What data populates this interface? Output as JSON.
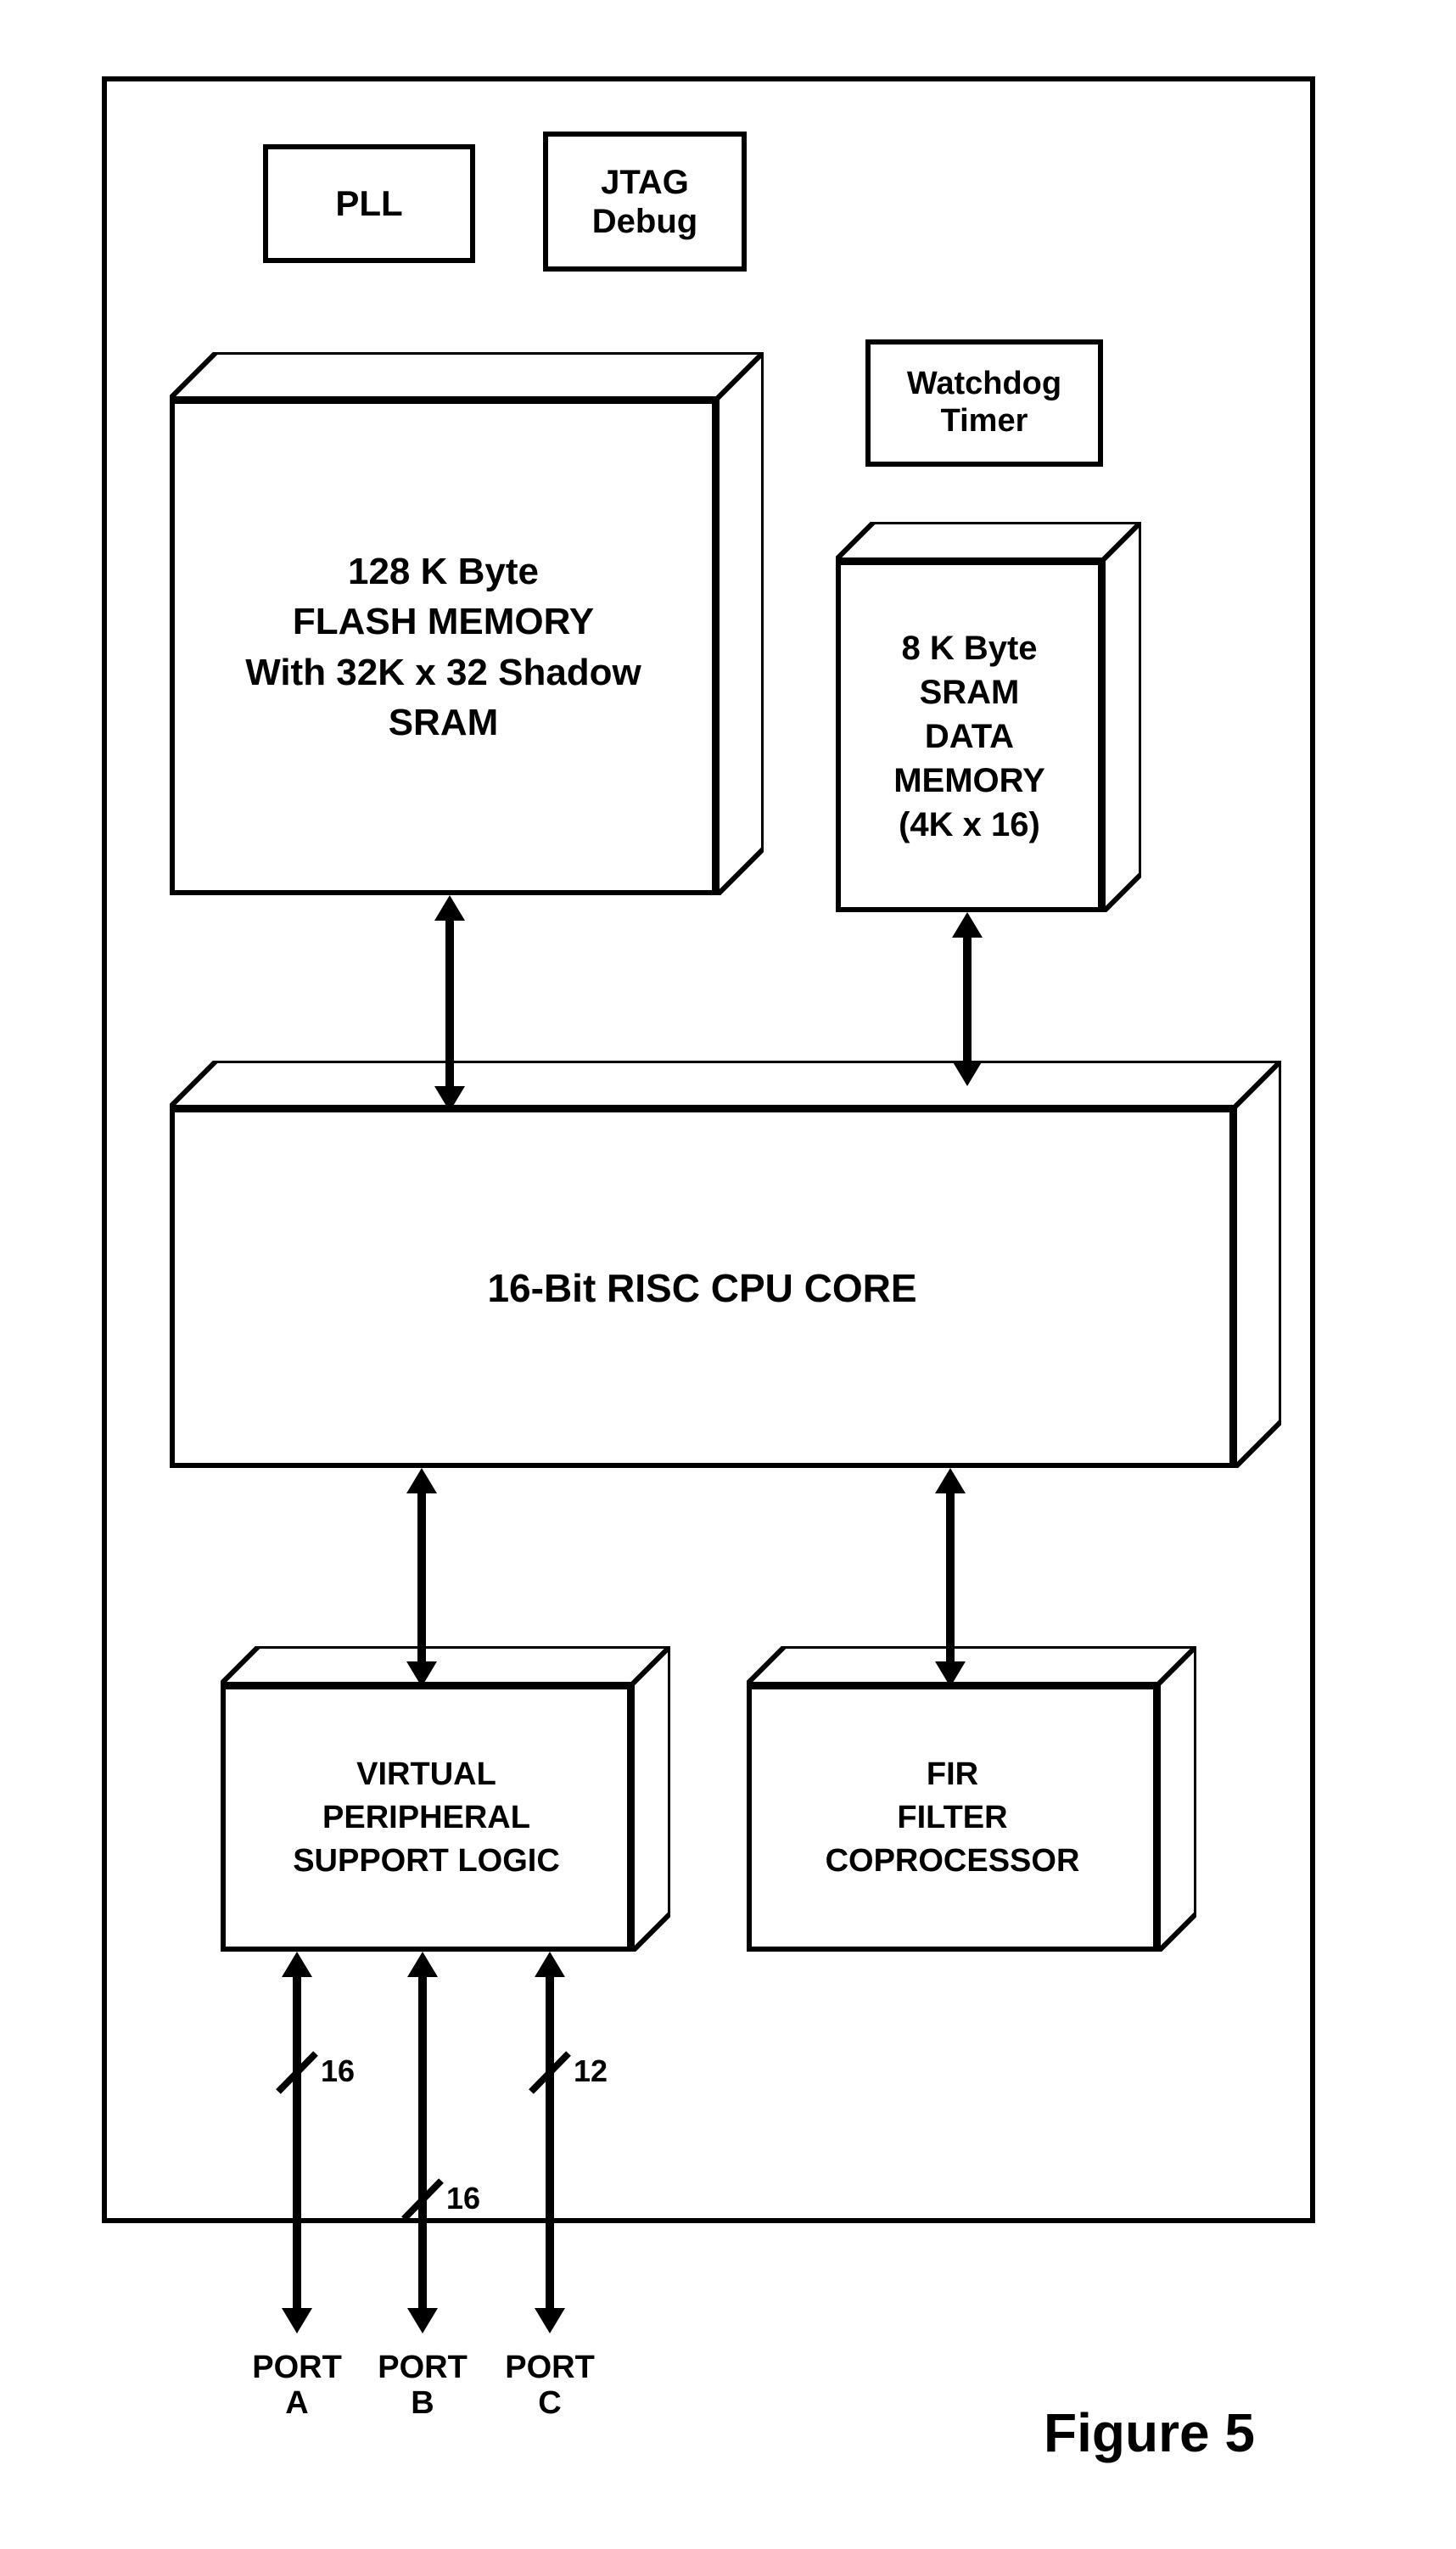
{
  "blocks": {
    "pll": "PLL",
    "jtag": "JTAG\nDebug",
    "watchdog": "Watchdog\nTimer",
    "flash": "128 K Byte\nFLASH MEMORY\nWith 32K x 32 Shadow\nSRAM",
    "sram": "8 K Byte\nSRAM\nDATA\nMEMORY\n(4K x 16)",
    "cpu": "16-Bit RISC CPU CORE",
    "vpsl": "VIRTUAL\nPERIPHERAL\nSUPPORT LOGIC",
    "fir": "FIR\nFILTER\nCOPROCESSOR"
  },
  "bus": {
    "a": "16",
    "b": "16",
    "c": "12"
  },
  "ports": {
    "a": "PORT\nA",
    "b": "PORT\nB",
    "c": "PORT\nC"
  },
  "figure": "Figure 5"
}
